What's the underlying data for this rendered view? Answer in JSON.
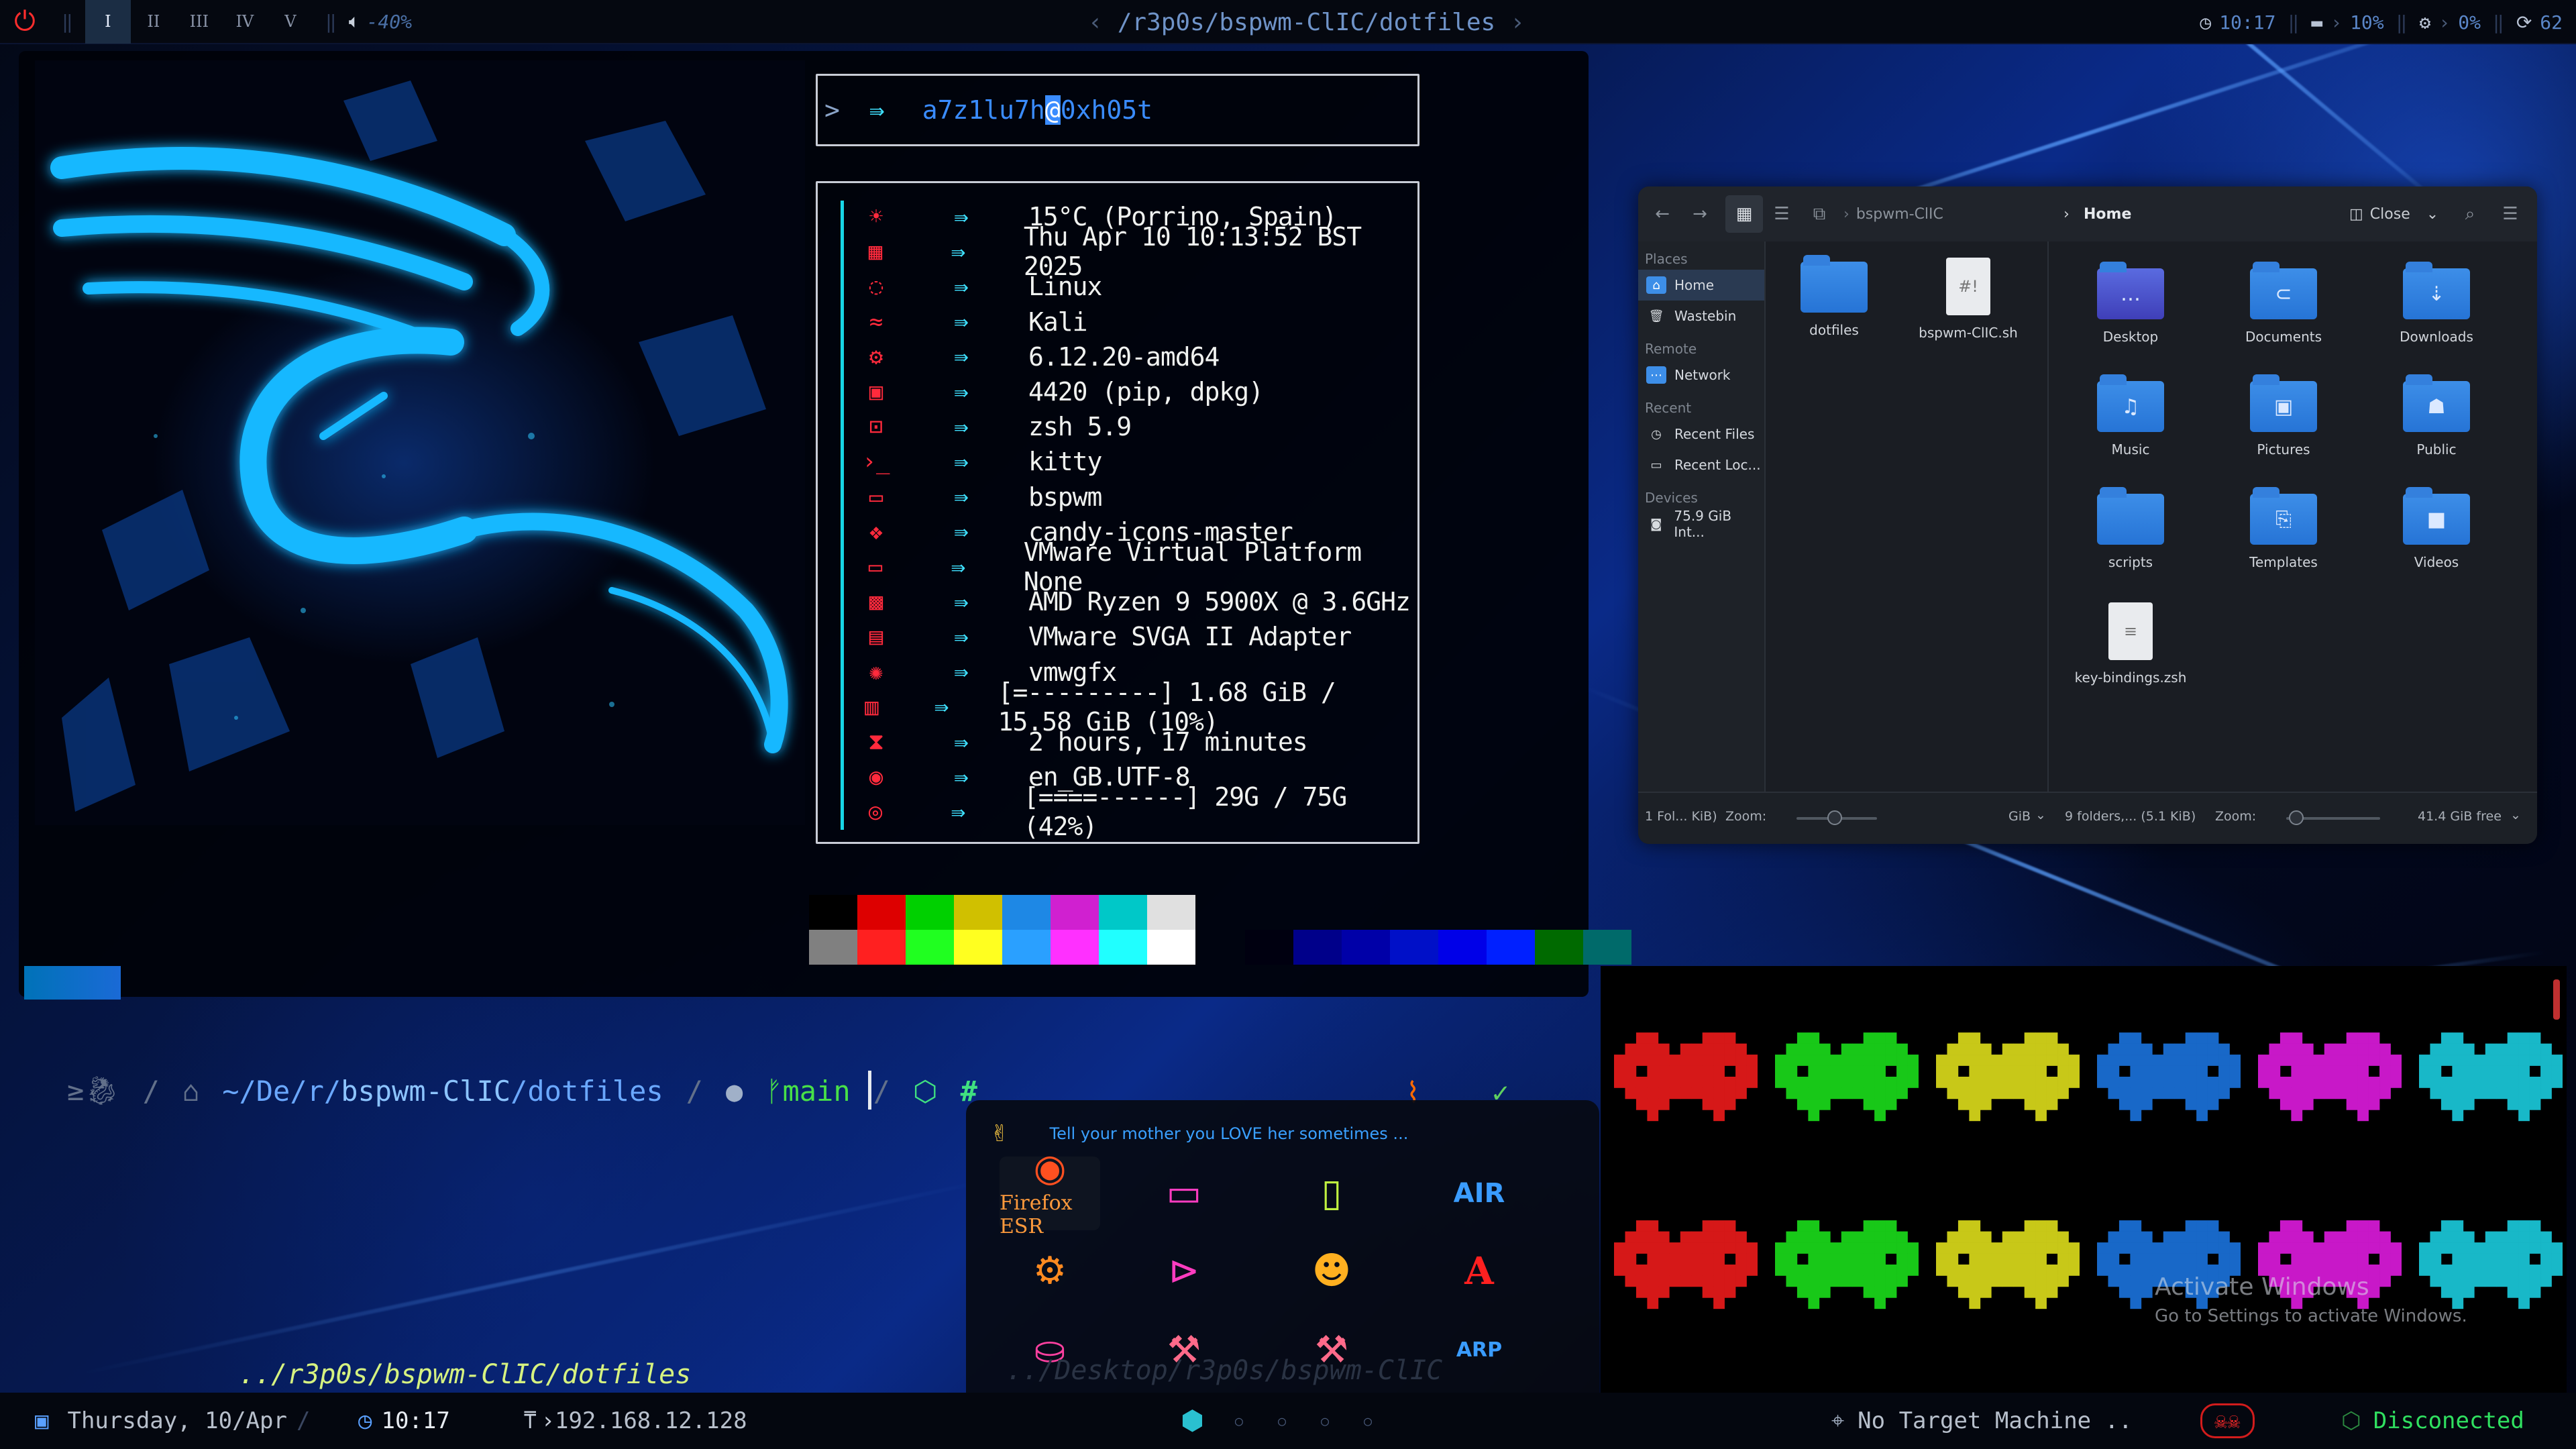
{
  "topbar": {
    "workspaces": [
      "I",
      "II",
      "III",
      "IV",
      "V"
    ],
    "active_workspace": "I",
    "volume": "-40%",
    "path": "/r3p0s/bspwm-ClIC/dotfiles",
    "time": "10:17",
    "memory": "10%",
    "cpu": "0%",
    "updates": "62"
  },
  "prompt": {
    "symbol": ">",
    "user": "a7z1lu7h",
    "at": "@",
    "host": "0xh05t"
  },
  "fetch": [
    {
      "icon": "weather-icon",
      "glyph": "☀",
      "value": "15°C (Porrino, Spain)"
    },
    {
      "icon": "calendar-icon",
      "glyph": "▦",
      "value": "Thu Apr 10 10:13:52 BST 2025"
    },
    {
      "icon": "os-icon",
      "glyph": "◌",
      "value": "Linux"
    },
    {
      "icon": "distro-icon",
      "glyph": "≈",
      "value": "Kali"
    },
    {
      "icon": "kernel-icon",
      "glyph": "⚙",
      "value": "6.12.20-amd64"
    },
    {
      "icon": "packages-icon",
      "glyph": "▣",
      "value": "4420 (pip, dpkg)"
    },
    {
      "icon": "shell-icon",
      "glyph": "⊡",
      "value": "zsh 5.9"
    },
    {
      "icon": "terminal-icon",
      "glyph": "›_",
      "value": "kitty"
    },
    {
      "icon": "wm-icon",
      "glyph": "▭",
      "value": "bspwm"
    },
    {
      "icon": "icons-theme-icon",
      "glyph": "❖",
      "value": "candy-icons-master"
    },
    {
      "icon": "host-icon",
      "glyph": "▭",
      "value": "VMware Virtual Platform None"
    },
    {
      "icon": "cpu-icon",
      "glyph": "▩",
      "value": "AMD Ryzen 9 5900X @ 3.6GHz"
    },
    {
      "icon": "gpu-icon",
      "glyph": "▤",
      "value": "VMware SVGA II Adapter"
    },
    {
      "icon": "driver-icon",
      "glyph": "✺",
      "value": "vmwgfx"
    },
    {
      "icon": "memory-icon",
      "glyph": "▥",
      "value": "[=---------] 1.68 GiB / 15.58 GiB (10%)"
    },
    {
      "icon": "uptime-icon",
      "glyph": "⧗",
      "value": "2 hours, 17 minutes"
    },
    {
      "icon": "locale-icon",
      "glyph": "◉",
      "value": "en_GB.UTF-8"
    },
    {
      "icon": "disk-icon",
      "glyph": "◎",
      "value": "[====------] 29G / 75G (42%)"
    }
  ],
  "colors": {
    "accent": "#3fe0ff",
    "icon_red": "#ff2a3c",
    "swatch_top": [
      "#000000",
      "#dd0000",
      "#00d000",
      "#d0c000",
      "#1e88e5",
      "#d020d0",
      "#00c8c8",
      "#e0e0e0"
    ],
    "swatch_bottom": [
      "#808080",
      "#ff2020",
      "#20ff20",
      "#ffff20",
      "#2aa0ff",
      "#ff30ff",
      "#20ffff",
      "#ffffff"
    ],
    "swatch_right": [
      "#000010",
      "#00008a",
      "#0000a8",
      "#0010c8",
      "#0000e8",
      "#0020ff",
      "#006a00",
      "#006a6a"
    ]
  },
  "shell": {
    "path_prefix": "~/De/r/",
    "path_dir": "bspwm-ClIC",
    "path_tail": "/dotfiles",
    "branch": "main",
    "cwd_echo": "../r3p0s/bspwm-ClIC/dotfiles"
  },
  "file_manager": {
    "breadcrumb_left": "bspwm-ClIC",
    "breadcrumb_right": "Home",
    "close_label": "Close",
    "sidebar": {
      "places_header": "Places",
      "places": [
        "Home",
        "Wastebin"
      ],
      "remote_header": "Remote",
      "remote": [
        "Network"
      ],
      "recent_header": "Recent",
      "recent": [
        "Recent Files",
        "Recent Loc..."
      ],
      "devices_header": "Devices",
      "devices": [
        "75.9 GiB Int..."
      ]
    },
    "left_items": [
      "dotfiles",
      "bspwm-ClIC.sh"
    ],
    "right_items": [
      "Desktop",
      "Documents",
      "Downloads",
      "Music",
      "Pictures",
      "Public",
      "scripts",
      "Templates",
      "Videos",
      "key-bindings.zsh"
    ],
    "status_left": "1 Fol... KiB)",
    "zoom_label": "Zoom:",
    "unit_left": "GiB",
    "status_right": "9 folders,... (5.1 KiB)",
    "free_space": "41.4 GiB free"
  },
  "launcher": {
    "message": "Tell your mother you LOVE her sometimes ...",
    "selected_app": "Firefox ESR",
    "ghost_text": "../Desktop/r3p0s/bspwm-ClIC"
  },
  "watermark": {
    "title": "Activate Windows",
    "subtitle": "Go to Settings to activate Windows."
  },
  "bottombar": {
    "date": "Thursday, 10/Apr",
    "time": "10:17",
    "ip": "192.168.12.128",
    "target": "No Target Machine ..",
    "vpn": "Disconected",
    "vpn_color": "#30e060"
  }
}
